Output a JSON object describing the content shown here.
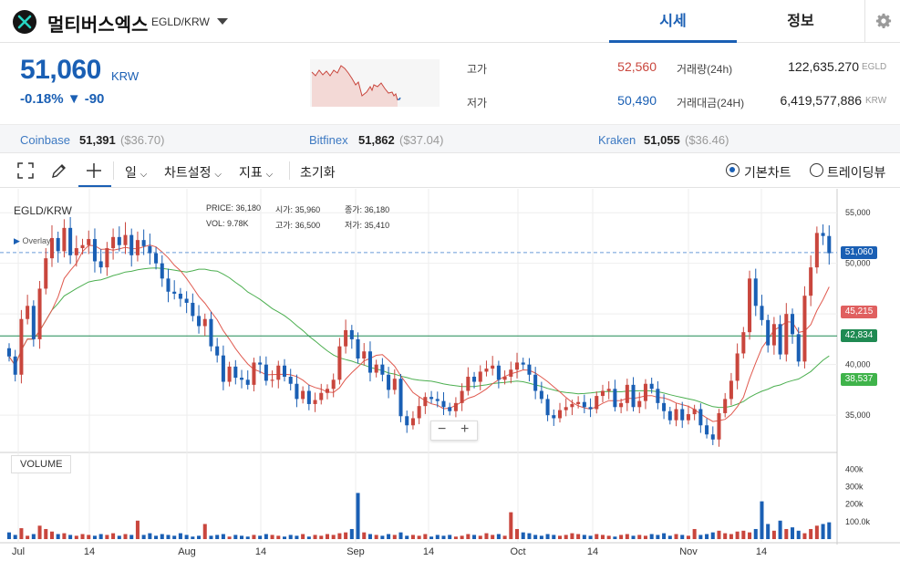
{
  "header": {
    "coin_name": "멀티버스엑스",
    "pair": "EGLD/KRW",
    "tabs": [
      "시세",
      "정보"
    ]
  },
  "price": {
    "current": "51,060",
    "unit": "KRW",
    "change_pct": "-0.18%",
    "change_abs": "▼ -90"
  },
  "stats": {
    "high_label": "고가",
    "high": "52,560",
    "low_label": "저가",
    "low": "50,490",
    "volume_label": "거래량(24h)",
    "volume": "122,635.270",
    "volume_unit": "EGLD",
    "amount_label": "거래대금(24H)",
    "amount": "6,419,577,886",
    "amount_unit": "KRW"
  },
  "exchanges": [
    {
      "name": "Coinbase",
      "price": "51,391",
      "usd": "($36.70)"
    },
    {
      "name": "Bitfinex",
      "price": "51,862",
      "usd": "($37.04)"
    },
    {
      "name": "Kraken",
      "price": "51,055",
      "usd": "($36.46)"
    }
  ],
  "toolbar": {
    "period": "일",
    "chart_settings": "차트설정",
    "indicators": "지표",
    "reset": "초기화",
    "mode_basic": "기본차트",
    "mode_tv": "트레이딩뷰"
  },
  "chart_data": {
    "type": "candlestick",
    "symbol": "EGLD/KRW",
    "overlay_label": "Overlay",
    "legend": {
      "price_label": "PRICE:",
      "price": "36,180",
      "vol_label": "VOL:",
      "vol": "9.78K",
      "open_label": "시가:",
      "open": "35,960",
      "high_label": "고가:",
      "high": "36,500",
      "close_label": "종가:",
      "close": "36,180",
      "low_label": "저가:",
      "low": "35,410"
    },
    "y_ticks": [
      "55,000",
      "50,000",
      "45,000",
      "40,000",
      "35,000"
    ],
    "ylim": [
      31500,
      57000
    ],
    "x_ticks": [
      "Jul",
      "14",
      "Aug",
      "14",
      "Sep",
      "14",
      "Oct",
      "14",
      "Nov",
      "14"
    ],
    "vol_ticks": [
      "400k",
      "300k",
      "200k",
      "100.0k"
    ],
    "volume_label": "VOLUME",
    "tags": [
      {
        "value": "51,060",
        "color": "#1a5fb4",
        "level": 51060
      },
      {
        "value": "45,215",
        "color": "#e06060",
        "level": 45215
      },
      {
        "value": "42,834",
        "color": "#1f8a52",
        "level": 42834
      },
      {
        "value": "38,537",
        "color": "#3fb34a",
        "level": 38537
      }
    ],
    "closes": [
      40800,
      39000,
      44500,
      45800,
      42500,
      47500,
      50500,
      52500,
      51200,
      53500,
      50800,
      51500,
      51800,
      52400,
      50200,
      49600,
      51500,
      52600,
      51800,
      52800,
      50800,
      52300,
      51700,
      51000,
      50000,
      48500,
      47200,
      47000,
      46500,
      46100,
      44800,
      43800,
      44500,
      41800,
      40900,
      38300,
      39800,
      38700,
      38500,
      38000,
      40200,
      40000,
      38400,
      38500,
      39900,
      38800,
      38100,
      36600,
      37400,
      36100,
      36500,
      37200,
      37600,
      38500,
      41800,
      43400,
      42500,
      40600,
      41300,
      39200,
      40000,
      39000,
      37500,
      38600,
      34900,
      34000,
      34700,
      35900,
      36800,
      36600,
      36400,
      35800,
      35400,
      36200,
      37400,
      38800,
      38300,
      39300,
      39600,
      39900,
      38500,
      38800,
      39500,
      40200,
      40000,
      39000,
      37400,
      36600,
      35000,
      34700,
      35500,
      35800,
      36100,
      36300,
      35800,
      35600,
      36900,
      37400,
      37600,
      35800,
      36200,
      38000,
      35800,
      36400,
      38100,
      37600,
      36200,
      35400,
      34500,
      35600,
      34500,
      35100,
      35600,
      34000,
      33100,
      32600,
      35200,
      36600,
      38400,
      41100,
      43200,
      48500,
      45800,
      44400,
      41900,
      44000,
      41000,
      45000,
      43000,
      40300,
      46800,
      49600,
      53000,
      52700,
      51000
    ],
    "volumes": [
      0.08,
      0.05,
      0.13,
      0.04,
      0.06,
      0.16,
      0.12,
      0.09,
      0.06,
      0.07,
      0.05,
      0.04,
      0.06,
      0.05,
      0.04,
      0.06,
      0.05,
      0.07,
      0.04,
      0.06,
      0.05,
      0.22,
      0.05,
      0.07,
      0.04,
      0.06,
      0.05,
      0.04,
      0.07,
      0.05,
      0.03,
      0.04,
      0.18,
      0.04,
      0.05,
      0.06,
      0.03,
      0.05,
      0.04,
      0.03,
      0.05,
      0.04,
      0.06,
      0.05,
      0.04,
      0.03,
      0.05,
      0.04,
      0.06,
      0.03,
      0.05,
      0.04,
      0.06,
      0.05,
      0.07,
      0.08,
      0.12,
      0.55,
      0.08,
      0.06,
      0.05,
      0.04,
      0.06,
      0.05,
      0.08,
      0.04,
      0.05,
      0.04,
      0.06,
      0.03,
      0.05,
      0.04,
      0.05,
      0.03,
      0.04,
      0.06,
      0.05,
      0.04,
      0.07,
      0.05,
      0.06,
      0.04,
      0.32,
      0.12,
      0.08,
      0.07,
      0.05,
      0.04,
      0.06,
      0.05,
      0.04,
      0.05,
      0.07,
      0.06,
      0.05,
      0.04,
      0.06,
      0.05,
      0.04,
      0.03,
      0.05,
      0.06,
      0.04,
      0.05,
      0.04,
      0.06,
      0.05,
      0.07,
      0.04,
      0.06,
      0.05,
      0.04,
      0.12,
      0.05,
      0.06,
      0.08,
      0.1,
      0.07,
      0.06,
      0.09,
      0.1,
      0.08,
      0.12,
      0.45,
      0.18,
      0.1,
      0.22,
      0.12,
      0.14,
      0.1,
      0.07,
      0.12,
      0.16,
      0.18,
      0.2,
      0.26,
      0.16
    ]
  }
}
